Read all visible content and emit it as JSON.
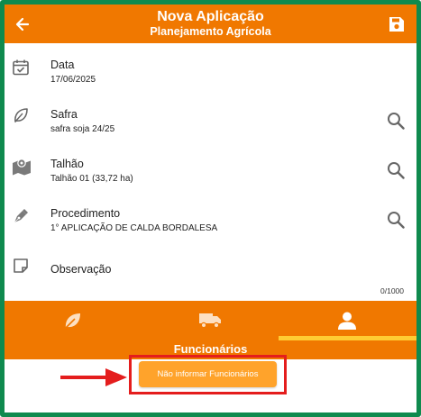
{
  "header": {
    "title": "Nova Aplicação",
    "subtitle": "Planejamento Agrícola",
    "back_icon": "arrow-left-icon",
    "save_icon": "floppy-disk-icon"
  },
  "fields": [
    {
      "icon": "calendar-check-icon",
      "label": "Data",
      "value": "17/06/2025",
      "searchable": false
    },
    {
      "icon": "leaf-icon",
      "label": "Safra",
      "value": "safra soja 24/25",
      "searchable": true
    },
    {
      "icon": "map-marker-icon",
      "label": "Talhão",
      "value": "Talhão 01 (33,72 ha)",
      "searchable": true
    },
    {
      "icon": "pen-nib-icon",
      "label": "Procedimento",
      "value": "1° APLICAÇÃO DE CALDA BORDALESA",
      "searchable": true
    },
    {
      "icon": "note-icon",
      "label": "Observação",
      "value": "",
      "searchable": false
    }
  ],
  "observacao_counter": "0/1000",
  "tabs": [
    {
      "icon": "leaf-icon",
      "active": false
    },
    {
      "icon": "truck-icon",
      "active": false
    },
    {
      "icon": "person-icon",
      "active": true
    }
  ],
  "section": {
    "title": "Funcionários"
  },
  "actions": {
    "no_employees_label": "Não informar Funcionários"
  },
  "colors": {
    "primary": "#f07800",
    "button": "#ffa32b",
    "tab_indicator": "#ffcc33",
    "frame": "#0f8a4e",
    "annotation": "#e41d1d"
  }
}
